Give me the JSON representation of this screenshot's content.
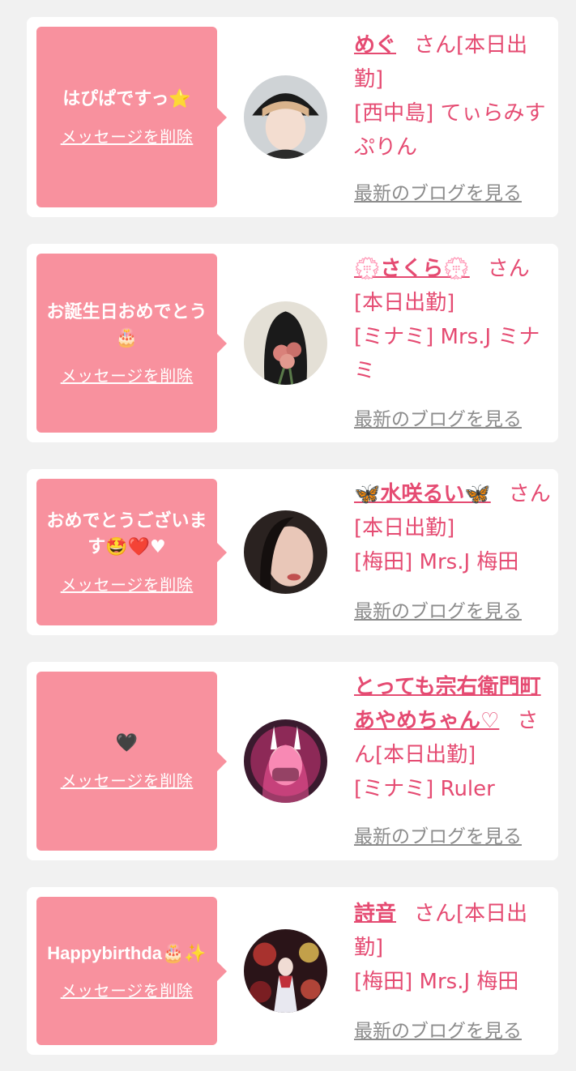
{
  "cards": [
    {
      "message": "はぴぱですっ⭐",
      "delete_label": "メッセージを削除",
      "name": "めぐ",
      "name_suffix": "さん[本日出勤]",
      "shop": "[西中島] てぃらみすぷりん",
      "blog_label": "最新のブログを見る"
    },
    {
      "message": "お誕生日おめでとう🎂",
      "delete_label": "メッセージを削除",
      "name": "💮さくら💮",
      "name_suffix": "さん[本日出勤]",
      "shop": "[ミナミ] Mrs.J ミナミ",
      "blog_label": "最新のブログを見る"
    },
    {
      "message": "おめでとうございます🤩❤️♥",
      "delete_label": "メッセージを削除",
      "name": "🦋水咲るい🦋",
      "name_suffix": "さん[本日出勤]",
      "shop": "[梅田] Mrs.J 梅田",
      "blog_label": "最新のブログを見る"
    },
    {
      "message": "🖤",
      "delete_label": "メッセージを削除",
      "name": "とっても宗右衛門町あやめちゃん♡",
      "name_suffix": "さん[本日出勤]",
      "shop": "[ミナミ] Ruler",
      "blog_label": "最新のブログを見る"
    },
    {
      "message": "Happybirthda🎂✨",
      "delete_label": "メッセージを削除",
      "name": "詩音",
      "name_suffix": "さん[本日出勤]",
      "shop": "[梅田] Mrs.J 梅田",
      "blog_label": "最新のブログを見る"
    }
  ],
  "colors": {
    "background": "#f1f1f1",
    "card": "#ffffff",
    "bubble": "#f8919e",
    "accent": "#e54b72",
    "link_gray": "#8c8c8c"
  }
}
